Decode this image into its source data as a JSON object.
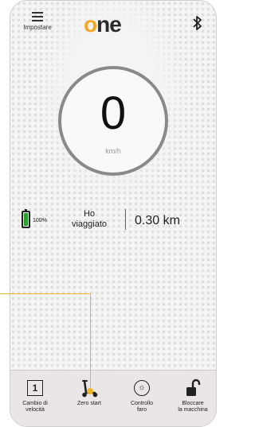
{
  "header": {
    "menu_label": "Impostare",
    "logo_o": "o",
    "logo_ne": "ne",
    "bluetooth_icon": "bluetooth-icon"
  },
  "speedometer": {
    "speed": "0",
    "unit": "km/h"
  },
  "trip": {
    "battery_percent_label": "100%",
    "traveled_label_line1": "Ho",
    "traveled_label_line2": "viaggiato",
    "distance": "0.30 km"
  },
  "bottom_nav": {
    "items": [
      {
        "label_line1": "Cambio di",
        "label_line2": "velocità",
        "icon": "speed-gear-1-icon",
        "glyph": "1"
      },
      {
        "label_line1": "Zero start",
        "label_line2": "",
        "icon": "scooter-icon"
      },
      {
        "label_line1": "Controllo",
        "label_line2": "faro",
        "icon": "headlight-icon",
        "glyph": "☼"
      },
      {
        "label_line1": "Bloccare",
        "label_line2": "la macchina",
        "icon": "lock-icon"
      }
    ]
  },
  "colors": {
    "accent": "#f5a623",
    "callout": "#f0b429",
    "battery_fill": "#2aa02a",
    "bottom_bar": "#ebe6e6"
  }
}
